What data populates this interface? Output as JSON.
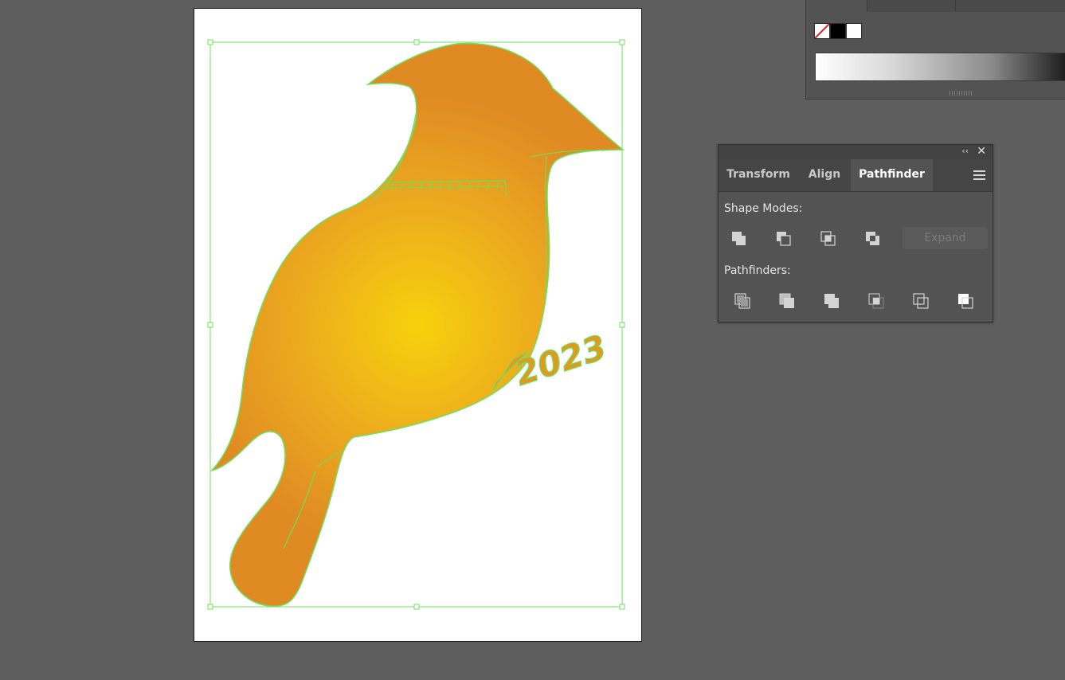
{
  "gradient_panel": {
    "swatches": [
      "none",
      "#000000",
      "#ffffff"
    ],
    "gradient_colors": [
      "#ffffff",
      "#1e1e1e"
    ]
  },
  "pathfinder_panel": {
    "collapse_glyph": "‹‹",
    "close_glyph": "✕",
    "tabs": [
      {
        "label": "Transform",
        "active": false
      },
      {
        "label": "Align",
        "active": false
      },
      {
        "label": "Pathfinder",
        "active": true
      }
    ],
    "shape_modes_label": "Shape Modes:",
    "shape_modes": [
      "unite-icon",
      "minus-front-icon",
      "intersect-icon",
      "exclude-icon"
    ],
    "expand_label": "Expand",
    "pathfinders_label": "Pathfinders:",
    "pathfinders": [
      "divide-icon",
      "trim-icon",
      "merge-icon",
      "crop-icon",
      "outline-icon",
      "minus-back-icon"
    ]
  },
  "artwork": {
    "text": "2023",
    "fill_center": "#f7d10c",
    "fill_edge": "#e08c22",
    "selection_color": "#6ee05a"
  }
}
